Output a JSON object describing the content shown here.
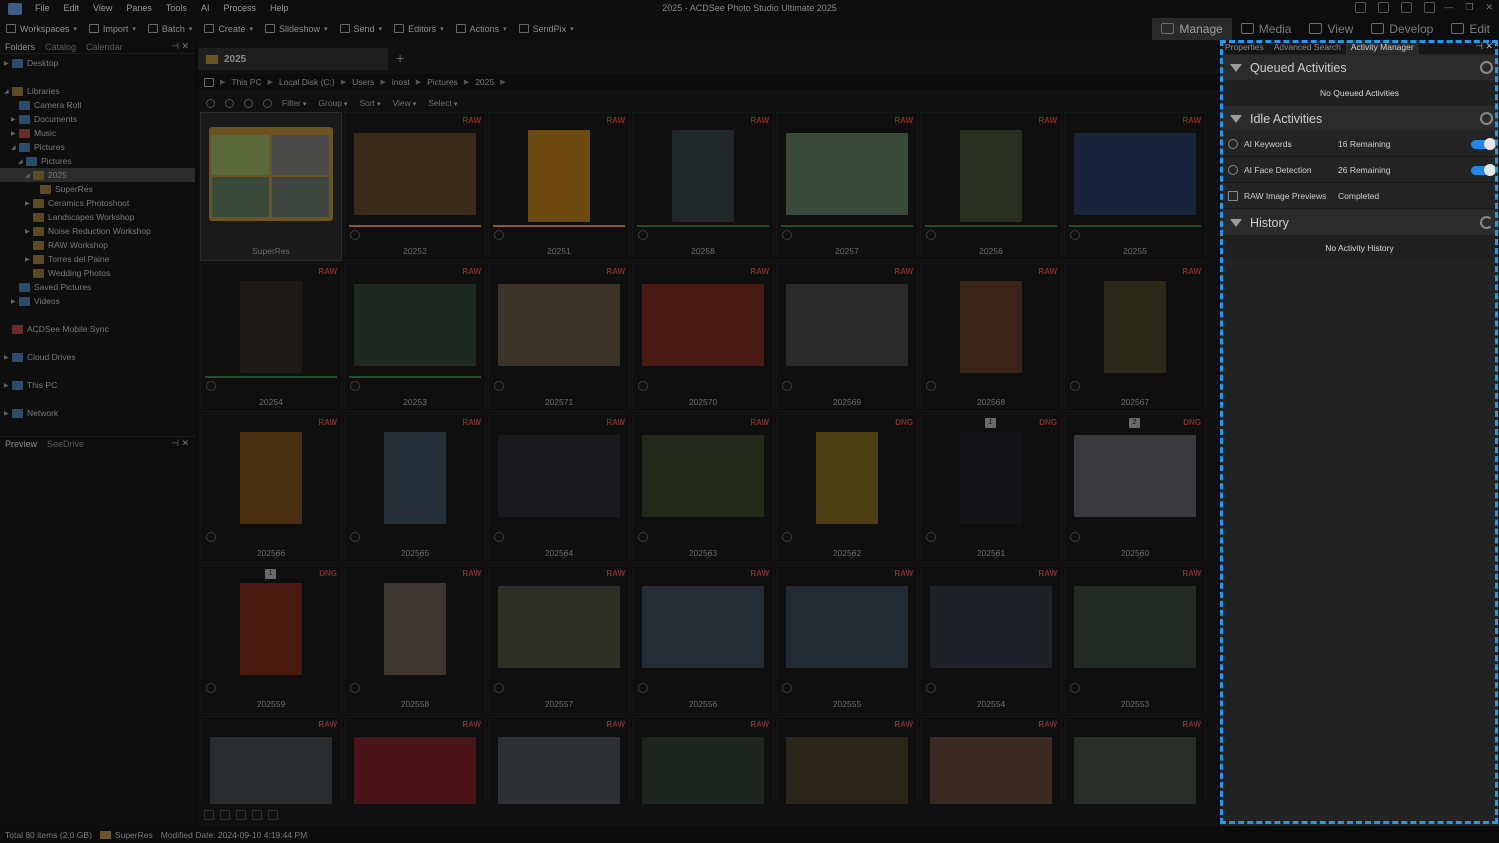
{
  "app": {
    "title": "2025 - ACDSee Photo Studio Ultimate 2025",
    "menu": [
      "File",
      "Edit",
      "View",
      "Panes",
      "Tools",
      "AI",
      "Process",
      "Help"
    ]
  },
  "toolbar": {
    "items": [
      "Workspaces",
      "Import",
      "Batch",
      "Create",
      "Slideshow",
      "Send",
      "Editors",
      "Actions",
      "SendPix"
    ],
    "modes": [
      "Manage",
      "Media",
      "View",
      "Develop",
      "Edit"
    ]
  },
  "left_panel": {
    "tabs": [
      "Folders",
      "Catalog",
      "Calendar"
    ],
    "tree": [
      {
        "label": "Desktop",
        "depth": 0,
        "icon": "blue",
        "twisty": "▶"
      },
      {
        "gap": true
      },
      {
        "label": "Libraries",
        "depth": 0,
        "icon": "folder",
        "twisty": "◢"
      },
      {
        "label": "Camera Roll",
        "depth": 1,
        "icon": "blue",
        "twisty": ""
      },
      {
        "label": "Documents",
        "depth": 1,
        "icon": "blue",
        "twisty": "▶"
      },
      {
        "label": "Music",
        "depth": 1,
        "icon": "red",
        "twisty": "▶"
      },
      {
        "label": "Pictures",
        "depth": 1,
        "icon": "blue",
        "twisty": "◢"
      },
      {
        "label": "Pictures",
        "depth": 2,
        "icon": "blue",
        "twisty": "◢"
      },
      {
        "label": "2025",
        "depth": 3,
        "icon": "folder",
        "twisty": "◢",
        "selected": true
      },
      {
        "label": "SuperRes",
        "depth": 4,
        "icon": "folder",
        "twisty": ""
      },
      {
        "label": "Ceramics Photoshoot",
        "depth": 3,
        "icon": "folder",
        "twisty": "▶"
      },
      {
        "label": "Landscapes Workshop",
        "depth": 3,
        "icon": "folder",
        "twisty": ""
      },
      {
        "label": "Noise Reduction Workshop",
        "depth": 3,
        "icon": "folder",
        "twisty": "▶"
      },
      {
        "label": "RAW Workshop",
        "depth": 3,
        "icon": "folder",
        "twisty": ""
      },
      {
        "label": "Torres del Paine",
        "depth": 3,
        "icon": "folder",
        "twisty": "▶"
      },
      {
        "label": "Wedding Photos",
        "depth": 3,
        "icon": "folder",
        "twisty": ""
      },
      {
        "label": "Saved Pictures",
        "depth": 1,
        "icon": "blue",
        "twisty": ""
      },
      {
        "label": "Videos",
        "depth": 1,
        "icon": "blue",
        "twisty": "▶"
      },
      {
        "gap": true
      },
      {
        "label": "ACDSee Mobile Sync",
        "depth": 0,
        "icon": "red",
        "twisty": ""
      },
      {
        "gap": true
      },
      {
        "label": "Cloud Drives",
        "depth": 0,
        "icon": "blue",
        "twisty": "▶"
      },
      {
        "gap": true
      },
      {
        "label": "This PC",
        "depth": 0,
        "icon": "blue",
        "twisty": "▶"
      },
      {
        "gap": true
      },
      {
        "label": "Network",
        "depth": 0,
        "icon": "blue",
        "twisty": "▶"
      }
    ],
    "preview_tabs": [
      "Preview",
      "SeeDrive"
    ]
  },
  "center": {
    "doc_tab": "2025",
    "breadcrumb": [
      "This PC",
      "Local Disk (C:)",
      "Users",
      "inost",
      "Pictures",
      "2025"
    ],
    "filterbar": [
      "Filter",
      "Group",
      "Sort",
      "View",
      "Select"
    ],
    "thumbnails": [
      {
        "caption": "SuperRes",
        "folder": true
      },
      {
        "caption": "20252",
        "badge": "RAW",
        "shape": "wide",
        "color": "#3a2a1a",
        "bar": "#8a5a20"
      },
      {
        "caption": "20251",
        "badge": "RAW",
        "shape": "tall",
        "color": "#6a4a10",
        "bar": "#8a5a20"
      },
      {
        "caption": "20258",
        "badge": "RAW",
        "shape": "tall",
        "color": "#20282a",
        "bar": "#1f4f2f"
      },
      {
        "caption": "20257",
        "badge": "RAW",
        "shape": "wide",
        "color": "#3a4a3a",
        "bar": "#1f4f2f"
      },
      {
        "caption": "20256",
        "badge": "RAW",
        "shape": "tall",
        "color": "#2a3020",
        "bar": "#1f4f2f"
      },
      {
        "caption": "20255",
        "badge": "RAW",
        "shape": "wide",
        "color": "#18243a",
        "bar": "#1f4f2f"
      },
      {
        "caption": "20254",
        "badge": "RAW",
        "shape": "tall",
        "color": "#1e1a18",
        "bar": "#1f4f2f"
      },
      {
        "caption": "20253",
        "badge": "RAW",
        "shape": "wide",
        "color": "#202822",
        "bar": "#1f4f2f"
      },
      {
        "caption": "202571",
        "badge": "RAW",
        "shape": "wide",
        "color": "#3a3428"
      },
      {
        "caption": "202570",
        "badge": "RAW",
        "shape": "wide",
        "color": "#4a1a14"
      },
      {
        "caption": "202569",
        "badge": "RAW",
        "shape": "wide",
        "color": "#2a2a2a"
      },
      {
        "caption": "202568",
        "badge": "RAW",
        "shape": "tall",
        "color": "#3a2418"
      },
      {
        "caption": "202567",
        "badge": "RAW",
        "shape": "tall",
        "color": "#2a2a18"
      },
      {
        "caption": "202566",
        "badge": "RAW",
        "shape": "tall",
        "color": "#4a2e10"
      },
      {
        "caption": "202565",
        "badge": "RAW",
        "shape": "tall",
        "color": "#24303a"
      },
      {
        "caption": "202564",
        "badge": "RAW",
        "shape": "wide",
        "color": "#1a1a1e"
      },
      {
        "caption": "202563",
        "badge": "RAW",
        "shape": "wide",
        "color": "#242a1a"
      },
      {
        "caption": "202562",
        "badge": "DNG",
        "shape": "tall",
        "color": "#4a3e10"
      },
      {
        "caption": "202561",
        "badge": "DNG",
        "shape": "tall",
        "color": "#141418",
        "num": "1"
      },
      {
        "caption": "202560",
        "badge": "DNG",
        "shape": "wide",
        "color": "#3a3a3e",
        "num": "2"
      },
      {
        "caption": "202559",
        "badge": "DNG",
        "shape": "tall",
        "color": "#4a1a10",
        "num": "1"
      },
      {
        "caption": "202558",
        "badge": "RAW",
        "shape": "tall",
        "color": "#3e3630"
      },
      {
        "caption": "202557",
        "badge": "RAW",
        "shape": "wide",
        "color": "#2e3028"
      },
      {
        "caption": "202556",
        "badge": "RAW",
        "shape": "wide",
        "color": "#262c36"
      },
      {
        "caption": "202555",
        "badge": "RAW",
        "shape": "wide",
        "color": "#222a34"
      },
      {
        "caption": "202554",
        "badge": "RAW",
        "shape": "wide",
        "color": "#1e2226"
      },
      {
        "caption": "202553",
        "badge": "RAW",
        "shape": "wide",
        "color": "#242a24"
      },
      {
        "caption": "",
        "badge": "RAW",
        "shape": "wide",
        "color": "#2a2c2e"
      },
      {
        "caption": "",
        "badge": "RAW",
        "shape": "wide",
        "color": "#4a1418"
      },
      {
        "caption": "",
        "badge": "RAW",
        "shape": "wide",
        "color": "#2e3034"
      },
      {
        "caption": "",
        "badge": "RAW",
        "shape": "wide",
        "color": "#1e2420"
      },
      {
        "caption": "",
        "badge": "RAW",
        "shape": "wide",
        "color": "#2a2618"
      },
      {
        "caption": "",
        "badge": "RAW",
        "shape": "wide",
        "color": "#3a2a22"
      },
      {
        "caption": "",
        "badge": "RAW",
        "shape": "wide",
        "color": "#2a2e2a"
      }
    ]
  },
  "right_panel": {
    "tabs": [
      "Properties",
      "Advanced Search",
      "Activity Manager"
    ],
    "queued": {
      "title": "Queued Activities",
      "empty": "No Queued Activities"
    },
    "idle": {
      "title": "Idle Activities",
      "rows": [
        {
          "name": "AI Keywords",
          "status": "16 Remaining",
          "toggle": true
        },
        {
          "name": "AI Face Detection",
          "status": "26 Remaining",
          "toggle": true
        },
        {
          "name": "RAW Image Previews",
          "status": "Completed",
          "toggle": false
        }
      ]
    },
    "history": {
      "title": "History",
      "empty": "No Activity History"
    }
  },
  "statusbar": {
    "total": "Total 80 items  (2.0 GB)",
    "folder": "SuperRes",
    "modified": "Modified Date: 2024-09-10 4:19:44 PM"
  },
  "colors": {
    "accent": "#1d9bf0",
    "toggle_on": "#1e88e5",
    "raw_badge": "#7a2f2f"
  }
}
